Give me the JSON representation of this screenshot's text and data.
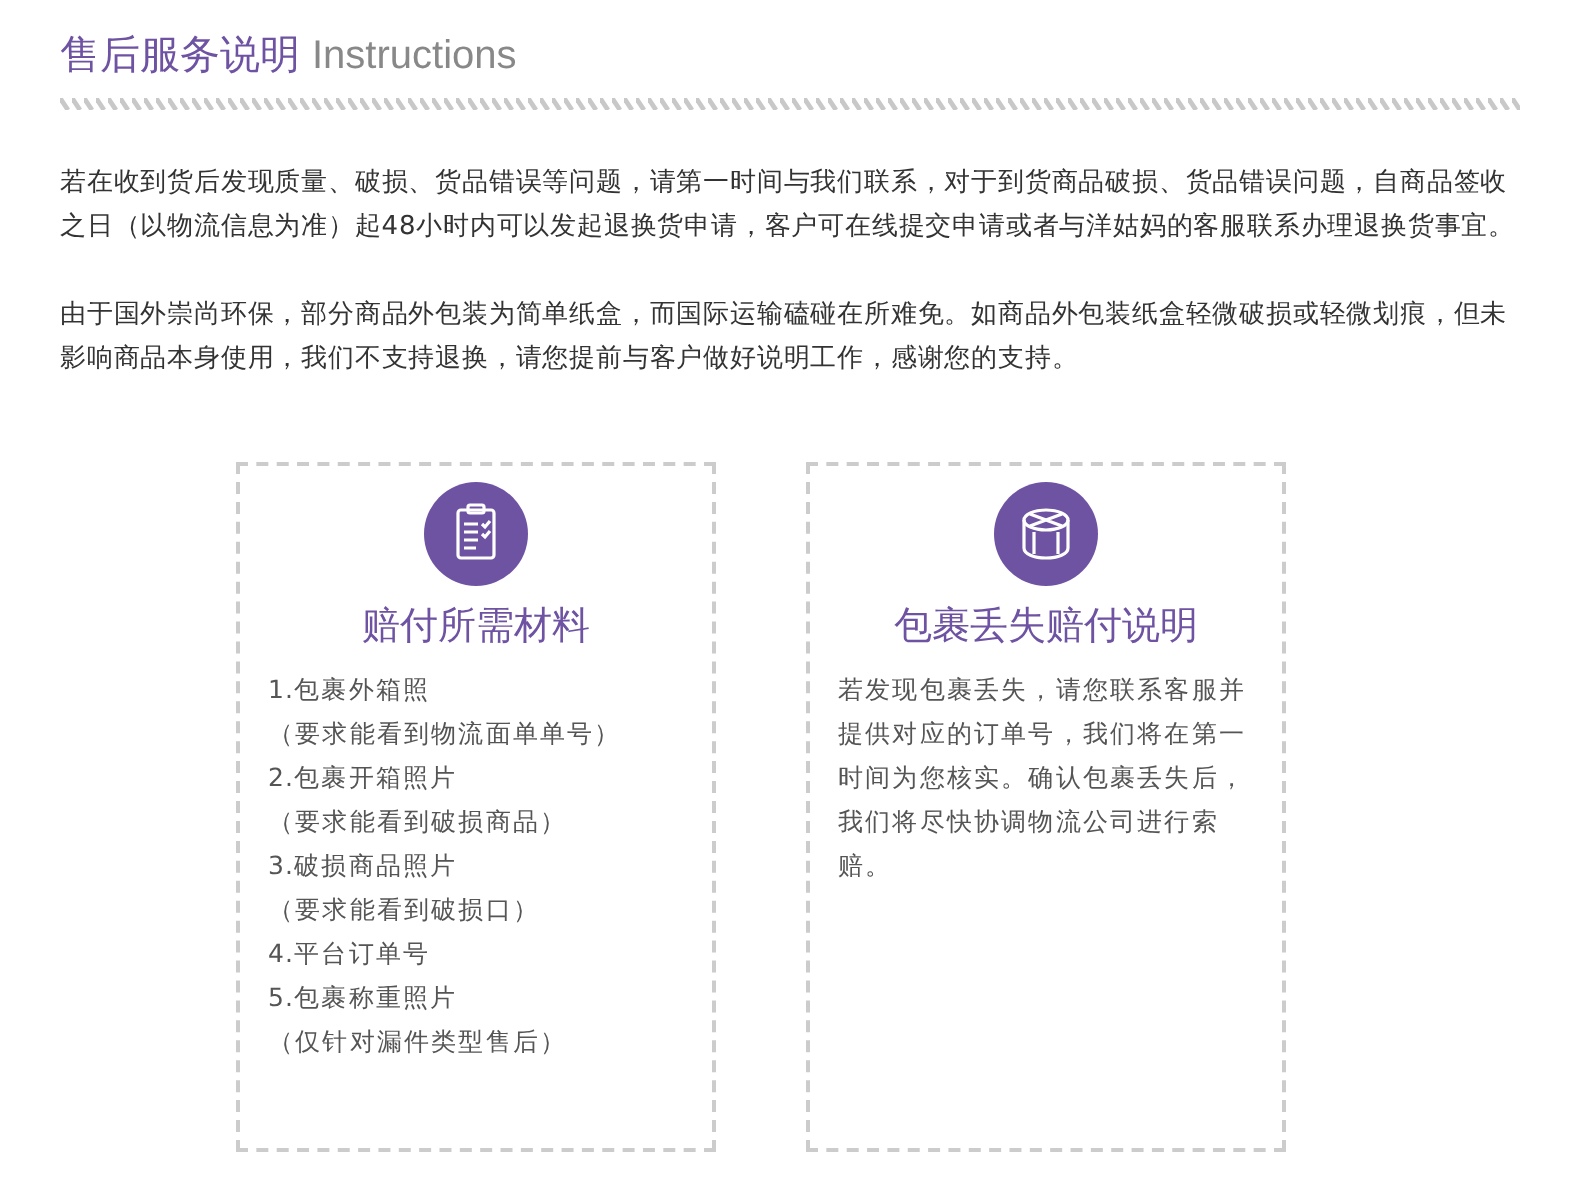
{
  "header": {
    "title": "售后服务说明",
    "subtitle": "Instructions"
  },
  "paragraphs": [
    "若在收到货后发现质量、破损、货品错误等问题，请第一时间与我们联系，对于到货商品破损、货品错误问题，自商品签收之日（以物流信息为准）起48小时内可以发起退换货申请，客户可在线提交申请或者与洋姑妈的客服联系办理退换货事宜。",
    "由于国外崇尚环保，部分商品外包装为简单纸盒，而国际运输磕碰在所难免。如商品外包装纸盒轻微破损或轻微划痕，但未影响商品本身使用，我们不支持退换，请您提前与客户做好说明工作，感谢您的支持。"
  ],
  "cards": [
    {
      "kind": "list",
      "title": "赔付所需材料",
      "lines": [
        "1.包裹外箱照",
        "（要求能看到物流面单单号）",
        "2.包裹开箱照片",
        "（要求能看到破损商品）",
        "3.破损商品照片",
        "（要求能看到破损口）",
        "4.平台订单号",
        "5.包裹称重照片",
        "（仅针对漏件类型售后）"
      ]
    },
    {
      "kind": "paragraph",
      "title": "包裹丢失赔付说明",
      "text": "若发现包裹丢失，请您联系客服并提供对应的订单号，我们将在第一时间为您核实。确认包裹丢失后，我们将尽快协调物流公司进行索赔。"
    }
  ]
}
